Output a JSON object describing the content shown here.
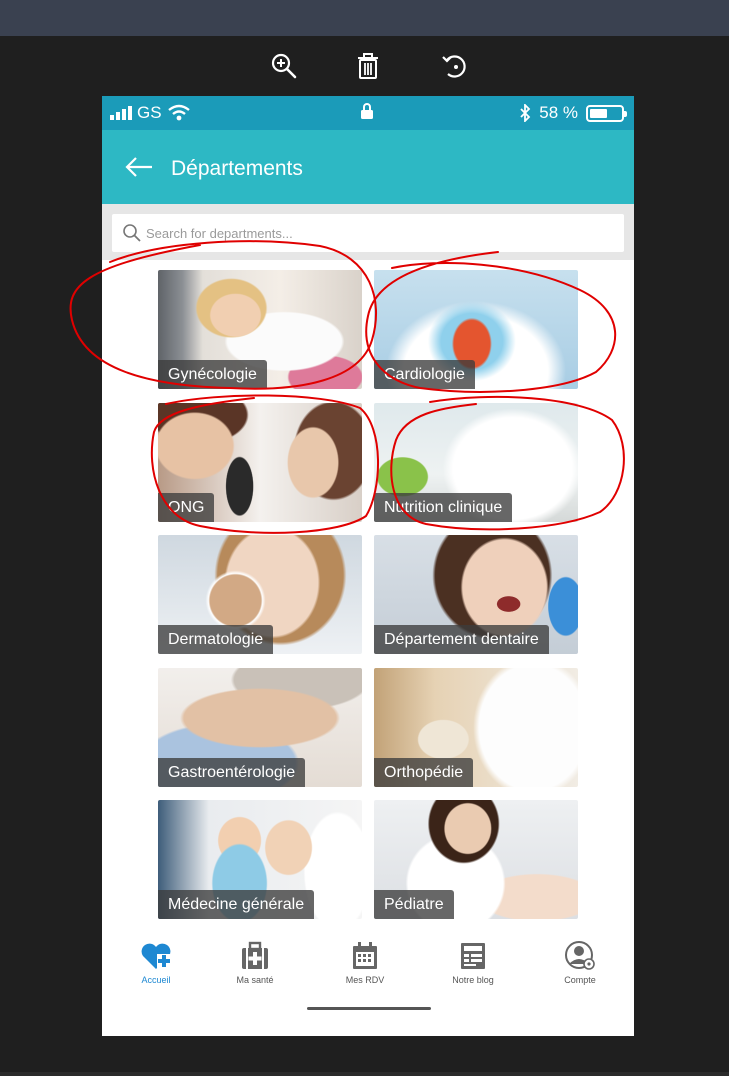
{
  "viewer": {
    "tools": [
      {
        "icon": "zoom-in-icon"
      },
      {
        "icon": "trash-icon"
      },
      {
        "icon": "rotate-icon"
      }
    ]
  },
  "statusbar": {
    "carrier": "GS",
    "battery_text": "58 %",
    "battery_level": 0.58,
    "icons": [
      "signal-icon",
      "wifi-icon",
      "lock-icon",
      "bluetooth-icon",
      "battery-icon"
    ]
  },
  "appbar": {
    "title": "Départements",
    "back_icon": "arrow-left-icon"
  },
  "search": {
    "placeholder": "Search for departments..."
  },
  "departments": [
    {
      "label": "Gynécologie",
      "circled": true
    },
    {
      "label": "Cardiologie",
      "circled": true
    },
    {
      "label": "ONG",
      "circled": true
    },
    {
      "label": "Nutrition clinique",
      "circled": true
    },
    {
      "label": "Dermatologie",
      "circled": false
    },
    {
      "label": "Département dentaire",
      "circled": false
    },
    {
      "label": "Gastroentérologie",
      "circled": false
    },
    {
      "label": "Orthopédie",
      "circled": false
    },
    {
      "label": "Médecine générale",
      "circled": false
    },
    {
      "label": "Pédiatre",
      "circled": false
    }
  ],
  "tabbar": {
    "items": [
      {
        "label": "Accueil",
        "icon": "heart-plus-icon",
        "active": true
      },
      {
        "label": "Ma santé",
        "icon": "medical-kit-icon",
        "active": false
      },
      {
        "label": "Mes RDV",
        "icon": "calendar-icon",
        "active": false
      },
      {
        "label": "Notre blog",
        "icon": "blog-icon",
        "active": false
      },
      {
        "label": "Compte",
        "icon": "account-icon",
        "active": false
      }
    ]
  },
  "colors": {
    "statusbar": "#1b9bb9",
    "appbar": "#2db8c4",
    "active_tab": "#1e88d2",
    "annotation": "#e00000"
  }
}
